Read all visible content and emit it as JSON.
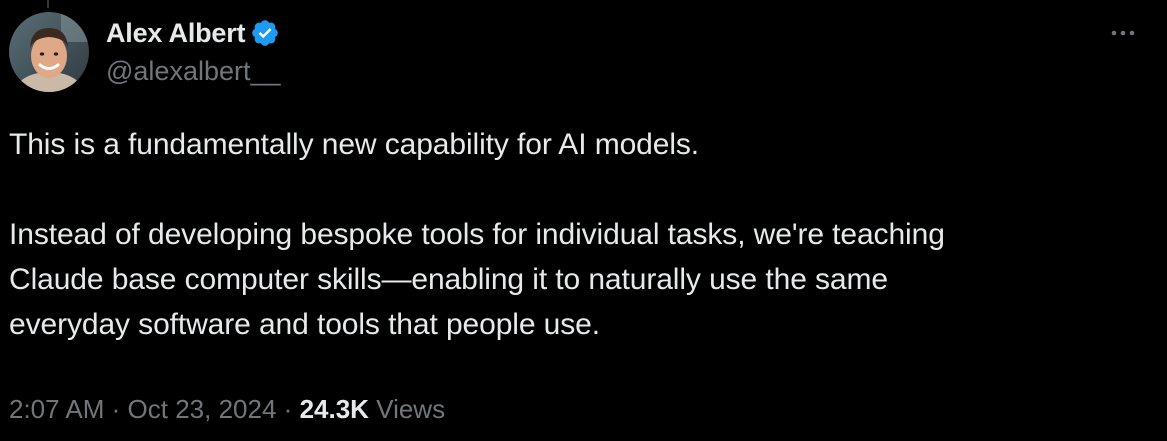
{
  "author": {
    "display_name": "Alex Albert",
    "handle": "@alexalbert__",
    "verified": true
  },
  "icons": {
    "verified": "verified-badge-icon",
    "more": "more-options-icon"
  },
  "colors": {
    "background": "#000000",
    "text_primary": "#e7e9ea",
    "text_secondary": "#71767b",
    "verified_blue": "#1d9bf0"
  },
  "tweet": {
    "paragraph1": "This is a fundamentally new capability for AI models.",
    "paragraph2_line1": "Instead of developing bespoke tools for individual tasks, we're teaching",
    "paragraph2_line2": "Claude base computer skills—enabling it to naturally use the same",
    "paragraph2_line3": "everyday software and tools that people use."
  },
  "meta": {
    "time": "2:07 AM",
    "separator": "·",
    "date": "Oct 23, 2024",
    "views_count": "24.3K",
    "views_label": "Views"
  }
}
